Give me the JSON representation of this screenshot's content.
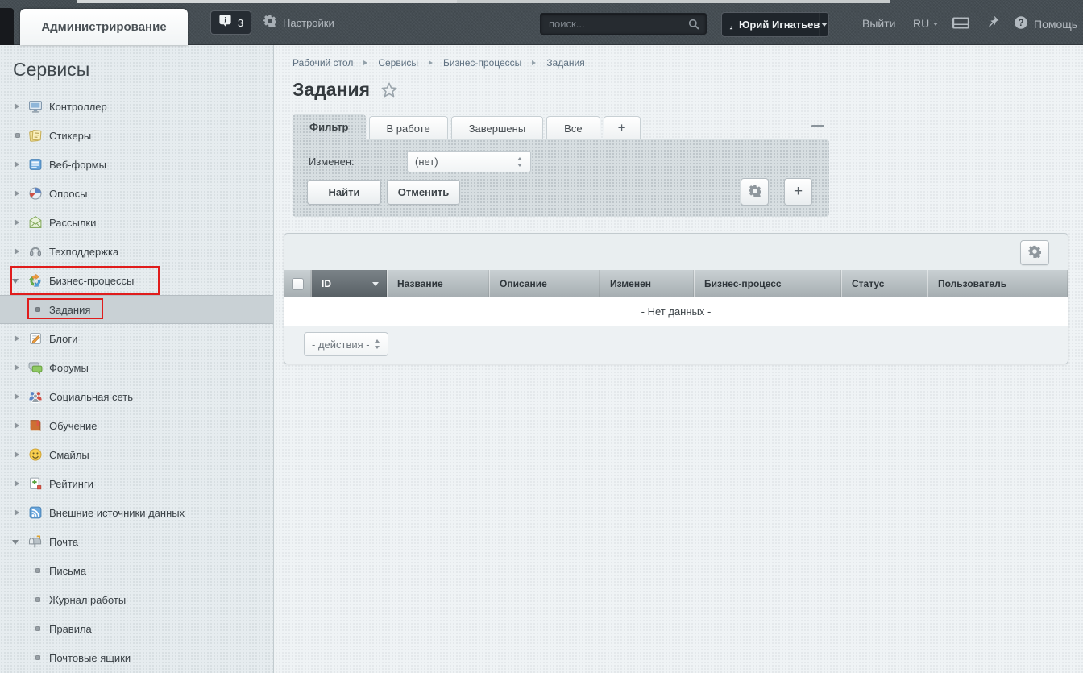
{
  "colors": {
    "annotation_red": "#e01c1c",
    "topbar_bg": "#454d53",
    "selected_item_bg": "#c9d1d5",
    "panel_bg": "#d7dee1"
  },
  "topbar": {
    "tab_label": "Администрирование",
    "notifications_count": "3",
    "settings_label": "Настройки",
    "search_placeholder": "поиск...",
    "user_name": "Юрий Игнатьев",
    "logout_label": "Выйти",
    "language_label": "RU",
    "help_label": "Помощь"
  },
  "sidebar": {
    "title": "Сервисы",
    "items": [
      {
        "label": "Контроллер",
        "marker": "arrow",
        "icon": "controller-icon"
      },
      {
        "label": "Стикеры",
        "marker": "bullet",
        "icon": "stickers-icon"
      },
      {
        "label": "Веб-формы",
        "marker": "arrow",
        "icon": "webforms-icon"
      },
      {
        "label": "Опросы",
        "marker": "arrow",
        "icon": "polls-icon"
      },
      {
        "label": "Рассылки",
        "marker": "arrow",
        "icon": "newsletters-icon"
      },
      {
        "label": "Техподдержка",
        "marker": "arrow",
        "icon": "support-icon"
      },
      {
        "label": "Бизнес-процессы",
        "marker": "arrow-open",
        "icon": "bizproc-icon",
        "annotated": true
      },
      {
        "label": "Задания",
        "marker": "bullet",
        "level": 2,
        "selected": true,
        "annotated": true
      },
      {
        "label": "Блоги",
        "marker": "arrow",
        "icon": "blogs-icon"
      },
      {
        "label": "Форумы",
        "marker": "arrow",
        "icon": "forums-icon"
      },
      {
        "label": "Социальная сеть",
        "marker": "arrow",
        "icon": "social-icon"
      },
      {
        "label": "Обучение",
        "marker": "arrow",
        "icon": "learning-icon"
      },
      {
        "label": "Смайлы",
        "marker": "arrow",
        "icon": "smiles-icon"
      },
      {
        "label": "Рейтинги",
        "marker": "arrow",
        "icon": "ratings-icon"
      },
      {
        "label": "Внешние источники данных",
        "marker": "arrow",
        "icon": "datasources-icon"
      },
      {
        "label": "Почта",
        "marker": "arrow-open",
        "icon": "mail-icon"
      },
      {
        "label": "Письма",
        "marker": "bullet",
        "level": 2
      },
      {
        "label": "Журнал работы",
        "marker": "bullet",
        "level": 2
      },
      {
        "label": "Правила",
        "marker": "bullet",
        "level": 2
      },
      {
        "label": "Почтовые ящики",
        "marker": "bullet",
        "level": 2
      }
    ]
  },
  "breadcrumb": {
    "items": [
      "Рабочий стол",
      "Сервисы",
      "Бизнес-процессы",
      "Задания"
    ]
  },
  "page": {
    "title": "Задания"
  },
  "filter": {
    "tabs": [
      {
        "label": "Фильтр",
        "active": true
      },
      {
        "label": "В работе"
      },
      {
        "label": "Завершены"
      },
      {
        "label": "Все"
      },
      {
        "label": "+",
        "add": true
      }
    ],
    "field_label": "Изменен:",
    "field_value": "(нет)",
    "find_label": "Найти",
    "cancel_label": "Отменить",
    "add_symbol": "+"
  },
  "grid": {
    "columns": [
      {
        "label": "ID",
        "sorted": true
      },
      {
        "label": "Название"
      },
      {
        "label": "Описание"
      },
      {
        "label": "Изменен"
      },
      {
        "label": "Бизнес-процесс"
      },
      {
        "label": "Статус"
      },
      {
        "label": "Пользователь"
      }
    ],
    "empty_text": "- Нет данных -",
    "actions_value": "- действия -"
  }
}
